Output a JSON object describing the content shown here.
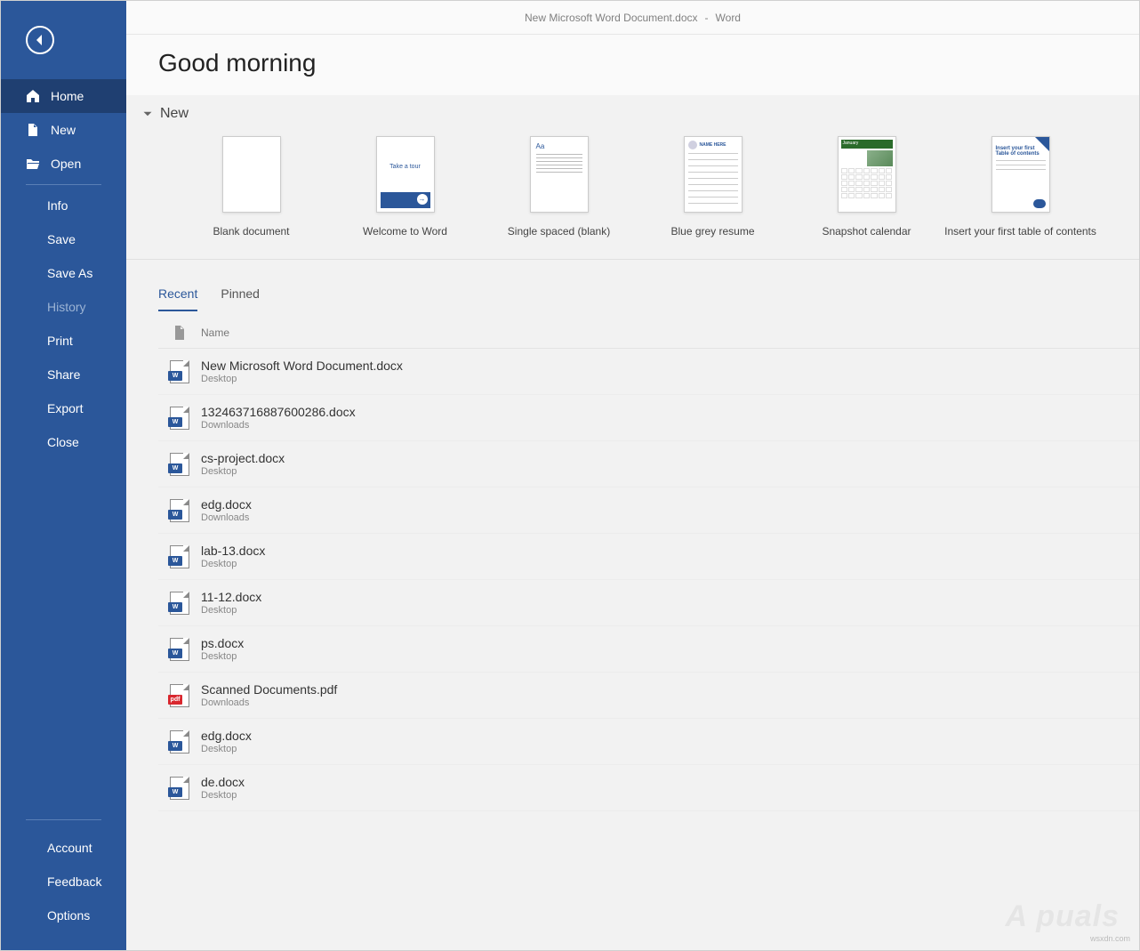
{
  "titlebar": {
    "filename": "New Microsoft Word Document.docx",
    "separator": "-",
    "appname": "Word"
  },
  "greeting": "Good morning",
  "sidebar": {
    "home": "Home",
    "new": "New",
    "open": "Open",
    "items": [
      "Info",
      "Save",
      "Save As",
      "History",
      "Print",
      "Share",
      "Export",
      "Close"
    ],
    "bottom": [
      "Account",
      "Feedback",
      "Options"
    ]
  },
  "new_section": {
    "title": "New"
  },
  "templates": [
    {
      "label": "Blank document"
    },
    {
      "label": "Welcome to Word",
      "tour": "Take a tour"
    },
    {
      "label": "Single spaced (blank)",
      "aa": "Aa"
    },
    {
      "label": "Blue grey resume",
      "name": "NAME HERE"
    },
    {
      "label": "Snapshot calendar",
      "month": "January"
    },
    {
      "label": "Insert your first table of contents",
      "txt": "Insert your first Table of contents"
    }
  ],
  "tabs": {
    "recent": "Recent",
    "pinned": "Pinned"
  },
  "list_header": {
    "name": "Name"
  },
  "recent": [
    {
      "name": "New Microsoft Word Document.docx",
      "loc": "Desktop",
      "type": "W"
    },
    {
      "name": "132463716887600286.docx",
      "loc": "Downloads",
      "type": "W"
    },
    {
      "name": "cs-project.docx",
      "loc": "Desktop",
      "type": "W"
    },
    {
      "name": "edg.docx",
      "loc": "Downloads",
      "type": "W"
    },
    {
      "name": "lab-13.docx",
      "loc": "Desktop",
      "type": "W"
    },
    {
      "name": "11-12.docx",
      "loc": "Desktop",
      "type": "W"
    },
    {
      "name": "ps.docx",
      "loc": "Desktop",
      "type": "W"
    },
    {
      "name": "Scanned Documents.pdf",
      "loc": "Downloads",
      "type": "pdf"
    },
    {
      "name": "edg.docx",
      "loc": "Desktop",
      "type": "W"
    },
    {
      "name": "de.docx",
      "loc": "Desktop",
      "type": "W"
    }
  ],
  "watermark": "wsxdn.com",
  "logo": "A  puals"
}
